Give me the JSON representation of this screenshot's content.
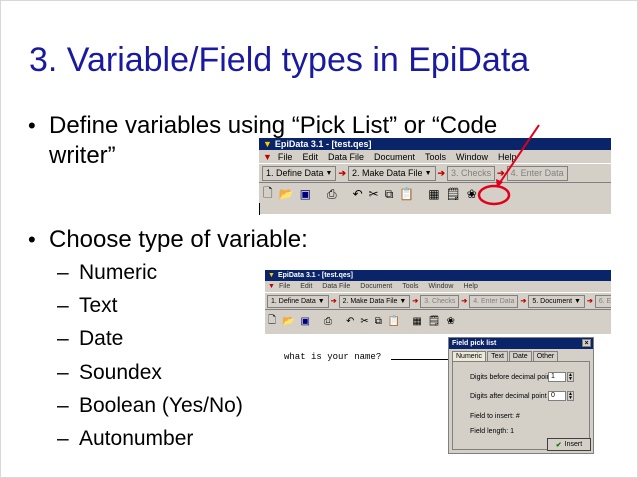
{
  "title": "3.  Variable/Field types in EpiData",
  "bullet1": {
    "line1": "Define variables using “Pick List” or “Code",
    "line2": "writer”"
  },
  "bullet2": "Choose type of variable:",
  "types": [
    "Numeric",
    "Text",
    "Date",
    "Soundex",
    "Boolean (Yes/No)",
    "Autonumber"
  ],
  "window1": {
    "title": "EpiData 3.1 - [test.qes]",
    "menu": [
      "File",
      "Edit",
      "Data File",
      "Document",
      "Tools",
      "Window",
      "Help"
    ],
    "toolbar": [
      "1. Define Data",
      "2. Make Data File",
      "3. Checks",
      "4. Enter Data"
    ]
  },
  "window2": {
    "title": "EpiData 3.1 - [test.qes]",
    "menu": [
      "File",
      "Edit",
      "Data File",
      "Document",
      "Tools",
      "Window",
      "Help"
    ],
    "toolbar": [
      "1. Define Data",
      "2. Make Data File",
      "3. Checks",
      "4. Enter Data",
      "5. Document",
      "6. Export D"
    ]
  },
  "editor_line": "what is your name?",
  "dialog": {
    "title": "Field pick list",
    "tabs": [
      "Numeric",
      "Text",
      "Date",
      "Other"
    ],
    "digits_before_label": "Digits before decimal point",
    "digits_before_value": "1",
    "digits_after_label": "Digits after decimal point",
    "digits_after_value": "0",
    "field_insert": "Field to insert: #",
    "field_length": "Field length: 1",
    "insert_label": "Insert"
  },
  "colors": {
    "title": "#1a1aa0",
    "titlebar": "#0a246a",
    "annotation": "#e0001b"
  }
}
